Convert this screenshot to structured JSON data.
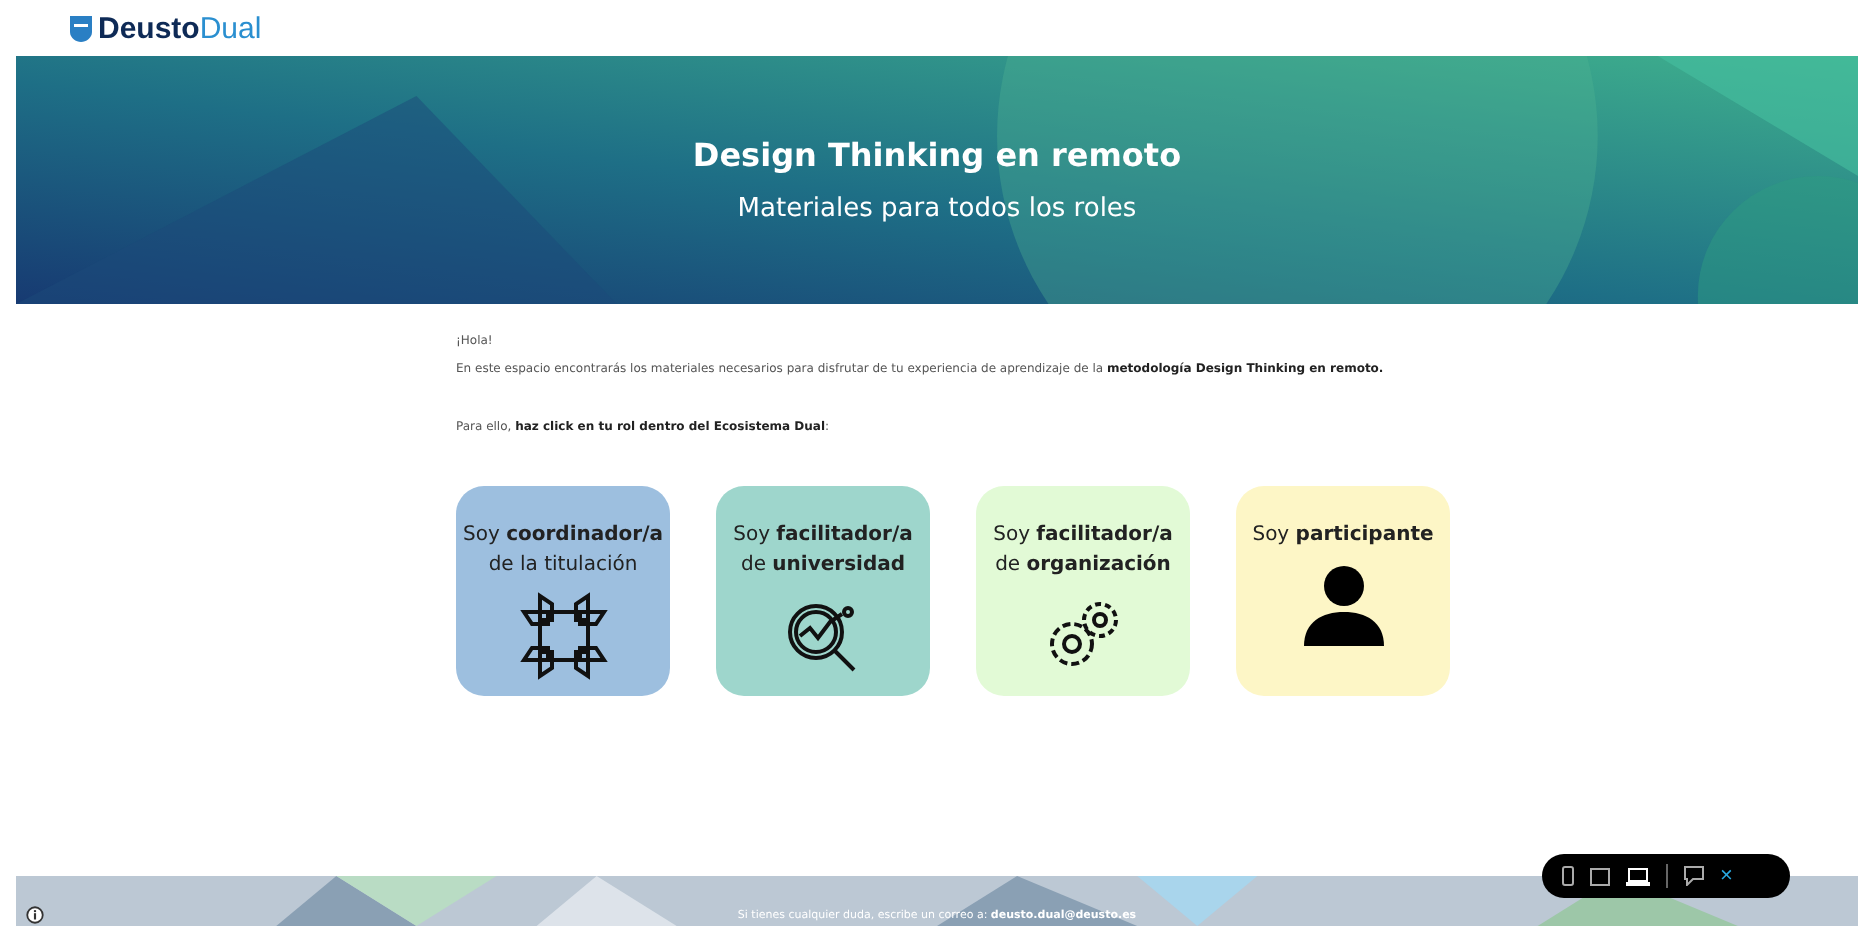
{
  "header": {
    "logo": {
      "part1": "Deusto",
      "part2": "Dual"
    }
  },
  "banner": {
    "title": "Design Thinking en remoto",
    "subtitle": "Materiales para todos los roles"
  },
  "intro": {
    "greeting": "¡Hola!",
    "paragraph": "En este espacio encontrarás los materiales necesarios para disfrutar de tu experiencia de aprendizaje de la **metodología Design Thinking en remoto.**",
    "prompt": "Para ello, **haz click en tu rol dentro del Ecosistema Dual**:"
  },
  "roles": [
    {
      "line1": "Soy **coordinador/a**",
      "line2": "de la titulación",
      "kind": "hands",
      "color": "#9dbfdf"
    },
    {
      "line1": "Soy **facilitador/a**",
      "line2": "de **universidad**",
      "kind": "magnifier",
      "color": "#9ed6cc"
    },
    {
      "line1": "Soy **facilitador/a**",
      "line2": "de **organización**",
      "kind": "gears",
      "color": "#e2fad6"
    },
    {
      "line1": "Soy **participante**",
      "kind": "person",
      "color": "#fdf6c6"
    }
  ],
  "footer": {
    "text": "Si tienes cualquier duda, escribe un correo a: **deusto.dual@deusto.es**"
  },
  "preview_toolbar": {
    "devices": [
      {
        "kind": "phone",
        "selected": false
      },
      {
        "kind": "tablet",
        "selected": false
      },
      {
        "kind": "laptop",
        "selected": true
      }
    ],
    "close": "×"
  }
}
